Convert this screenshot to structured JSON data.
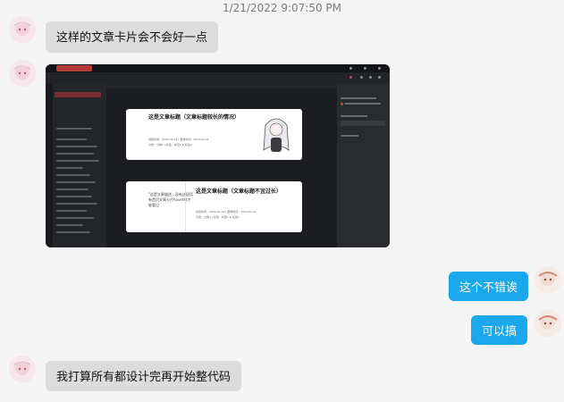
{
  "timestamp": "1/21/2022 9:07:50 PM",
  "messages": [
    {
      "side": "left",
      "text": "这样的文章卡片会不会好一点"
    },
    {
      "side": "left",
      "type": "screenshot"
    },
    {
      "side": "right",
      "text": "这个不错诶"
    },
    {
      "side": "right",
      "text": "可以搞"
    },
    {
      "side": "left",
      "text": "我打算所有都设计完再开始整代码"
    }
  ],
  "screenshot": {
    "card1_title": "这是文章标题（文章标题较长的情况）",
    "card1_meta": "创建时间：2022-01-21 | 更新时间：2022-01-21",
    "card1_tags": "分类：分类1 | 标签：标签1 & 标签2",
    "card2_quote": "\"这是文章描述，没有这段话有首页文章卡片hover时才能看见",
    "card2_title": "这是文章标题（文章标题不宜过长）",
    "card2_meta": "创建时间：2022-01-21 | 更新时间：2022-01-21",
    "card2_tags": "分类：分类1 | 标签：标签1 & 标签2"
  },
  "colors": {
    "left_bubble": "#dcdcdc",
    "right_bubble": "#1aa7ec",
    "app_bg": "#1e1f22",
    "accent": "#b13b3b"
  }
}
